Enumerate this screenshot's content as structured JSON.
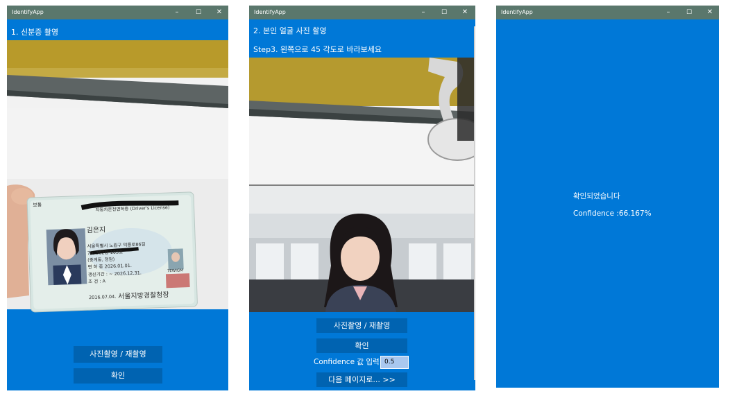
{
  "app_title": "IdentifyApp",
  "window_controls": {
    "minimize": "–",
    "maximize": "☐",
    "close": "✕"
  },
  "window1": {
    "heading": "1. 신분증 촬영",
    "capture_button": "사진촬영 / 재촬영",
    "confirm_button": "확인",
    "photo": {
      "card_title": "자동차운전면허증 (Driver's License)",
      "card_badge": "보통",
      "name": "김은지",
      "address_line1": "서울특별시 노원구 덕릉로86길",
      "address_line2": "70, 302동 103호",
      "address_line3": "(중계동, 청암)",
      "issue_line": "면 허 증  2026.01.01.",
      "validity_line": "갱신기간 : ~ 2026.12.31.",
      "condition_line": "조   건 : A",
      "serial": "7EWIGM",
      "issue_date": "2016.07.04.",
      "issuer": "서울지방경찰청장"
    }
  },
  "window2": {
    "heading": "2. 본인 얼굴 사진 촬영",
    "instruction": "Step3. 왼쪽으로 45 각도로 바라보세요",
    "capture_button": "사진촬영 / 재촬영",
    "confirm_button": "확인",
    "confidence_label": "Confidence 값 입력:",
    "confidence_value": "0.5",
    "next_button": "다음 페이지로... >>"
  },
  "window3": {
    "result_text": "확인되었습니다",
    "confidence_text": "Confidence :66.167%"
  },
  "colors": {
    "titlebar": "#5a776c",
    "client": "#0078d7",
    "button": "#0063b1",
    "input": "#a9c8ef"
  }
}
